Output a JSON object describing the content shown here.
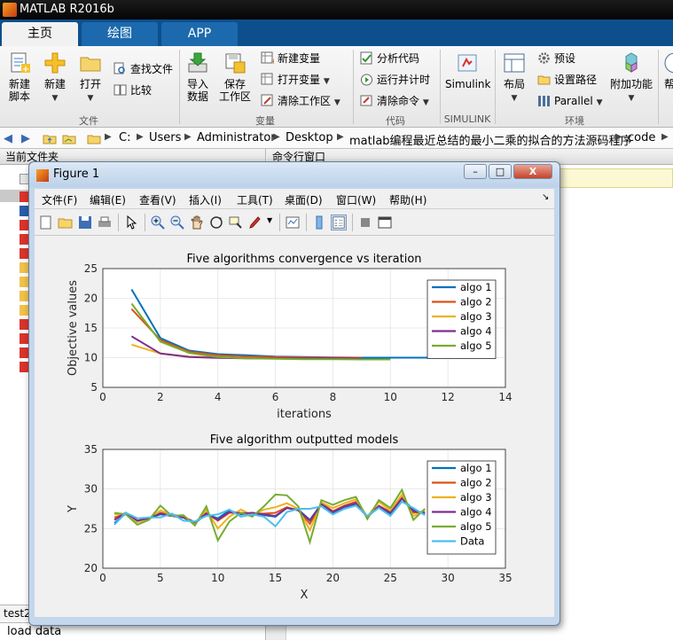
{
  "app": {
    "title": "MATLAB R2016b"
  },
  "tabs": [
    {
      "label": "主页",
      "active": true
    },
    {
      "label": "绘图",
      "active": false
    },
    {
      "label": "APP",
      "active": false
    }
  ],
  "ribbon": {
    "file": {
      "new_script": "新建\n脚本",
      "new": "新建",
      "open": "打开",
      "find_files": "查找文件",
      "compare": "比较",
      "group": "文件"
    },
    "variable": {
      "import": "导入\n数据",
      "save_ws": "保存\n工作区",
      "new_var": "新建变量",
      "open_var": "打开变量",
      "clear_ws": "清除工作区",
      "group": "变量"
    },
    "code": {
      "analyze": "分析代码",
      "run_time": "运行并计时",
      "clear_cmd": "清除命令",
      "group": "代码"
    },
    "simulink": {
      "label": "Simulink",
      "group": "SIMULINK"
    },
    "env": {
      "layout": "布局",
      "prefs": "预设",
      "set_path": "设置路径",
      "parallel": "Parallel",
      "addons": "附加功能",
      "group": "环境"
    },
    "help_cut": "帮"
  },
  "address": {
    "crumbs": [
      "C:",
      "Users",
      "Administrator",
      "Desktop",
      "matlab编程最近总结的最小二乘的拟合的方法源码程序",
      "code"
    ]
  },
  "panels": {
    "current_folder": "当前文件夹",
    "command_window": "命令行窗口",
    "workspace_item": "test2",
    "bottom_text": "load data"
  },
  "figure": {
    "title": "Figure 1",
    "min": "–",
    "max": "□",
    "close": "X",
    "menu": [
      "文件(F)",
      "编辑(E)",
      "查看(V)",
      "插入(I)",
      "工具(T)",
      "桌面(D)",
      "窗口(W)",
      "帮助(H)"
    ]
  },
  "colors": {
    "algo1": "#0072BD",
    "algo2": "#D95319",
    "algo3": "#EDB120",
    "algo4": "#7E2F8E",
    "algo5": "#77AC30",
    "data": "#4DBEEE"
  },
  "chart_data": [
    {
      "type": "line",
      "title": "Five algorithms convergence vs iteration",
      "xlabel": "iterations",
      "ylabel": "Objective values",
      "xlim": [
        0,
        14
      ],
      "ylim": [
        5,
        25
      ],
      "xticks": [
        0,
        2,
        4,
        6,
        8,
        10,
        12,
        14
      ],
      "yticks": [
        5,
        10,
        15,
        20,
        25
      ],
      "grid": true,
      "legend": "top-right",
      "series": [
        {
          "name": "algo 1",
          "x": [
            1,
            2,
            3,
            4,
            5,
            6,
            7,
            8,
            9,
            10,
            11,
            12,
            13
          ],
          "y": [
            21.5,
            13.3,
            11.2,
            10.6,
            10.4,
            10.2,
            10.1,
            10.05,
            10.0,
            10.0,
            10.0,
            10.0,
            10.0
          ]
        },
        {
          "name": "algo 2",
          "x": [
            1,
            2,
            3,
            4,
            5,
            6,
            7,
            8,
            9
          ],
          "y": [
            18.2,
            13.0,
            11.0,
            10.4,
            10.2,
            10.1,
            10.05,
            10.0,
            10.0
          ]
        },
        {
          "name": "algo 3",
          "x": [
            1,
            2,
            3,
            4,
            5,
            6,
            7,
            8,
            9
          ],
          "y": [
            12.2,
            10.7,
            10.2,
            10.0,
            9.9,
            9.85,
            9.85,
            9.85,
            9.85
          ]
        },
        {
          "name": "algo 4",
          "x": [
            1,
            2,
            3,
            4,
            5,
            6,
            7,
            8,
            9
          ],
          "y": [
            13.6,
            10.7,
            10.1,
            9.95,
            9.9,
            9.9,
            9.9,
            9.9,
            9.9
          ]
        },
        {
          "name": "algo 5",
          "x": [
            1,
            2,
            3,
            4,
            5,
            6,
            7,
            8,
            9,
            10
          ],
          "y": [
            19.1,
            12.7,
            10.8,
            10.1,
            9.9,
            9.8,
            9.75,
            9.75,
            9.7,
            9.7
          ]
        }
      ]
    },
    {
      "type": "line",
      "title": "Five algorithm outputted models",
      "xlabel": "X",
      "ylabel": "Y",
      "xlim": [
        0,
        35
      ],
      "ylim": [
        20,
        35
      ],
      "xticks": [
        0,
        5,
        10,
        15,
        20,
        25,
        30,
        35
      ],
      "yticks": [
        20,
        25,
        30,
        35
      ],
      "grid": true,
      "legend": "top-right",
      "x": [
        1,
        2,
        3,
        4,
        5,
        6,
        7,
        8,
        9,
        10,
        11,
        12,
        13,
        14,
        15,
        16,
        17,
        18,
        19,
        20,
        21,
        22,
        23,
        24,
        25,
        26,
        27,
        28
      ],
      "series": [
        {
          "name": "algo 1",
          "y": [
            25.7,
            26.9,
            26.0,
            26.3,
            26.8,
            26.6,
            26.4,
            25.7,
            26.8,
            26.3,
            27.3,
            26.8,
            27.0,
            26.7,
            26.5,
            27.6,
            27.4,
            26.1,
            28.1,
            27.0,
            27.7,
            28.0,
            26.5,
            27.7,
            26.9,
            28.8,
            27.4,
            26.9
          ]
        },
        {
          "name": "algo 2",
          "y": [
            26.4,
            26.9,
            25.9,
            26.2,
            27.0,
            26.8,
            26.5,
            25.8,
            27.0,
            26.0,
            27.0,
            27.0,
            26.9,
            26.9,
            27.0,
            27.7,
            27.3,
            25.6,
            28.2,
            27.2,
            27.9,
            28.4,
            26.5,
            27.9,
            27.1,
            28.9,
            27.0,
            27.1
          ]
        },
        {
          "name": "algo 3",
          "y": [
            26.8,
            26.9,
            25.8,
            26.2,
            27.3,
            26.7,
            26.6,
            25.6,
            27.4,
            25.0,
            26.5,
            27.4,
            26.7,
            27.4,
            27.7,
            28.2,
            27.5,
            24.8,
            28.3,
            27.6,
            28.2,
            28.7,
            26.5,
            28.4,
            27.3,
            29.3,
            26.6,
            27.2
          ]
        },
        {
          "name": "algo 4",
          "y": [
            26.1,
            27.0,
            26.0,
            26.3,
            26.9,
            26.6,
            26.4,
            25.8,
            26.9,
            26.1,
            27.1,
            26.9,
            27.0,
            26.8,
            26.6,
            27.6,
            27.3,
            26.0,
            28.1,
            27.1,
            27.8,
            28.2,
            26.5,
            27.8,
            27.0,
            28.8,
            27.2,
            27.0
          ]
        },
        {
          "name": "algo 5",
          "y": [
            27.0,
            26.8,
            25.5,
            26.1,
            27.9,
            26.6,
            26.7,
            25.4,
            27.8,
            23.5,
            25.9,
            27.0,
            26.5,
            27.8,
            29.3,
            29.2,
            27.8,
            23.3,
            28.6,
            28.0,
            28.6,
            29.0,
            26.2,
            28.6,
            27.6,
            29.9,
            26.1,
            27.5
          ]
        },
        {
          "name": "Data",
          "y": [
            25.5,
            27.0,
            26.3,
            26.4,
            26.4,
            26.9,
            26.0,
            25.9,
            26.6,
            26.8,
            27.4,
            26.5,
            26.8,
            26.5,
            25.3,
            27.1,
            27.5,
            27.5,
            27.8,
            26.8,
            27.5,
            27.9,
            26.6,
            27.6,
            26.6,
            28.4,
            27.6,
            26.7
          ]
        }
      ]
    }
  ]
}
